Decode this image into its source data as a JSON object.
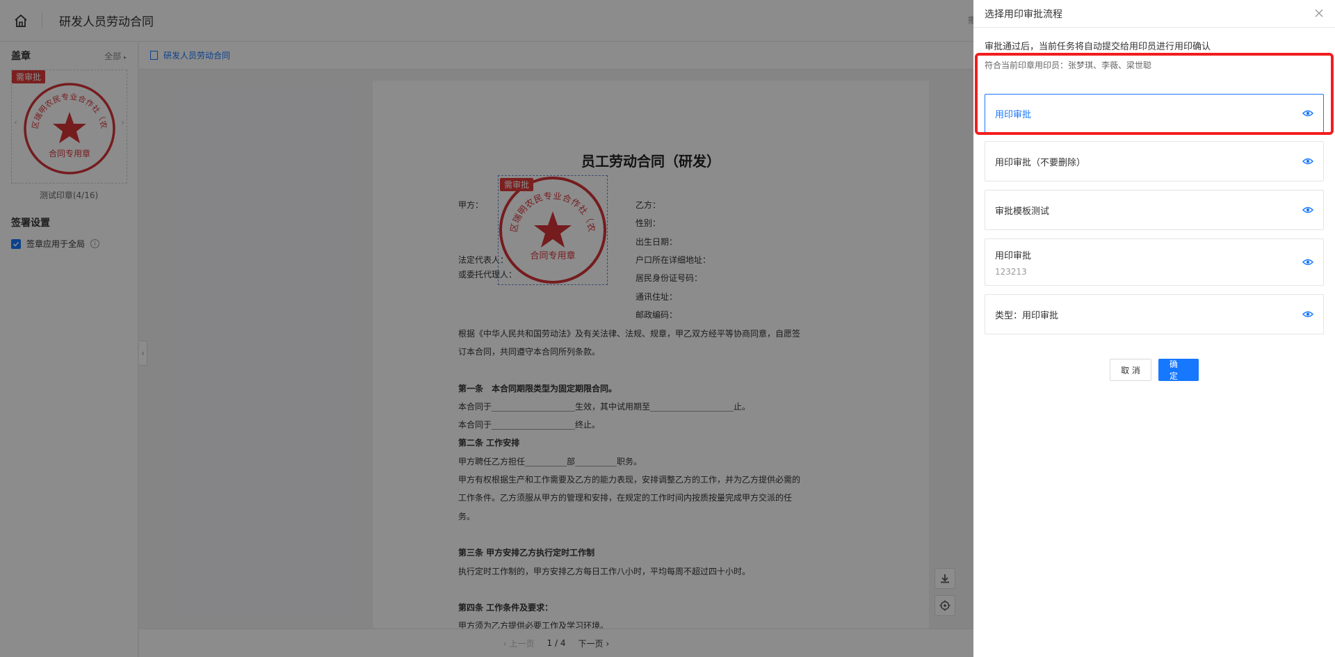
{
  "header": {
    "title": "研发人员劳动合同",
    "right_hint": "撤"
  },
  "sidebar": {
    "seal_section_title": "盖章",
    "seal_all_link": "全部",
    "seal_badge": "需审批",
    "seal_stamp_arc": "盐城市亭湖区瑞明农民专业合作社（农民合作社）",
    "seal_stamp_bottom": "合同专用章",
    "seal_name": "测试印章(4/16)",
    "sign_section_title": "签署设置",
    "apply_all_label": "签章应用于全局"
  },
  "main": {
    "breadcrumb": "研发人员劳动合同",
    "pager": {
      "prev": "上一页",
      "page": "1 / 4",
      "next": "下一页"
    }
  },
  "document": {
    "title": "员工劳动合同（研发）",
    "stamp_badge": "需审批",
    "stamp_arc": "盐城市亭湖区瑞明农民专业合作社（农民合作社）",
    "stamp_bottom": "合同专用章",
    "party_a": "甲方：",
    "legal_rep": "法定代表人：",
    "agent": "或委托代理人：",
    "party_b": "乙方：",
    "gender": "性别：",
    "birth": "出生日期：",
    "household": "户口所在详细地址：",
    "id_no": "居民身份证号码：",
    "address": "通讯住址：",
    "postcode": "邮政编码：",
    "intro1": "根据《中华人民共和国劳动法》及有关法律、法规、规章，甲乙双方经平等协商同意，自愿签",
    "intro2": "订本合同，共同遵守本合同所列条款。",
    "art1_title": "第一条　本合同期限类型为固定期限合同。",
    "art1_l1": "本合同于____________________生效，其中试用期至____________________止。",
    "art1_l2": "本合同于____________________终止。",
    "art2_title": "第二条 工作安排",
    "art2_l1": "甲方聘任乙方担任__________部__________职务。",
    "art2_l2": "甲方有权根据生产和工作需要及乙方的能力表现，安排调整乙方的工作，并为乙方提供必需的",
    "art2_l3": "工作条件。乙方须服从甲方的管理和安排，在规定的工作时间内按质按量完成甲方交派的任",
    "art2_l4": "务。",
    "art3_title": "第三条 甲方安排乙方执行定时工作制",
    "art3_l1": "执行定时工作制的，甲方安排乙方每日工作八小时，平均每周不超过四十小时。",
    "art4_title": "第四条 工作条件及要求：",
    "art4_l1": "甲方须为乙方提供必要工作及学习环境。"
  },
  "drawer": {
    "title": "选择用印审批流程",
    "notice": "审批通过后，当前任务将自动提交给用印员进行用印确认",
    "matched": "符合当前印章用印员：张梦琪、李薇、梁世聪",
    "flows": [
      {
        "name": "用印审批",
        "sub": ""
      },
      {
        "name": "用印审批（不要删除）",
        "sub": ""
      },
      {
        "name": "审批模板测试",
        "sub": ""
      },
      {
        "name": "用印审批",
        "sub": "123213"
      },
      {
        "name": "类型：用印审批",
        "sub": ""
      }
    ],
    "cancel": "取 消",
    "confirm": "确 定"
  },
  "colors": {
    "accent": "#1677ff",
    "seal_red": "#d6343a",
    "highlight": "#f21d1d"
  }
}
